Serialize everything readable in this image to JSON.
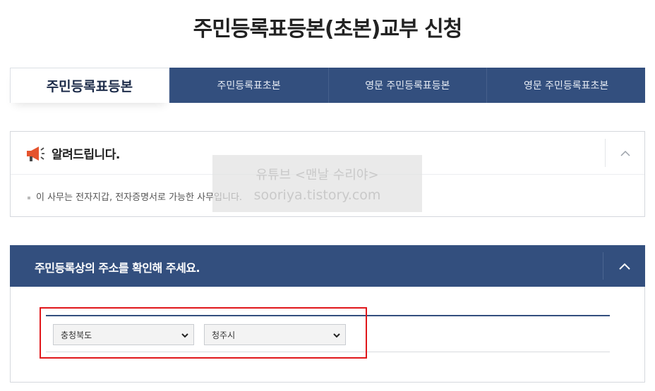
{
  "page": {
    "title": "주민등록표등본(초본)교부 신청"
  },
  "tabs": [
    {
      "label": "주민등록표등본",
      "active": true
    },
    {
      "label": "주민등록표초본",
      "active": false
    },
    {
      "label": "영문 주민등록표등본",
      "active": false
    },
    {
      "label": "영문 주민등록표초본",
      "active": false
    }
  ],
  "notice": {
    "icon": "megaphone-icon",
    "title": "알려드립니다.",
    "toggle_icon": "chevron-up-icon",
    "message": "이 사무는 전자지갑, 전자증명서로 가능한 사무입니다."
  },
  "watermark": {
    "line1": "유튜브 <맨날 수리야>",
    "line2": "sooriya.tistory.com"
  },
  "address": {
    "title": "주민등록상의 주소를 확인해 주세요.",
    "toggle_icon": "chevron-up-icon",
    "province_select": {
      "value": "충청북도"
    },
    "city_select": {
      "value": "청주시"
    }
  },
  "colors": {
    "primary": "#334f7e",
    "highlight": "#e0171b",
    "megaphone": "#e5532d"
  }
}
